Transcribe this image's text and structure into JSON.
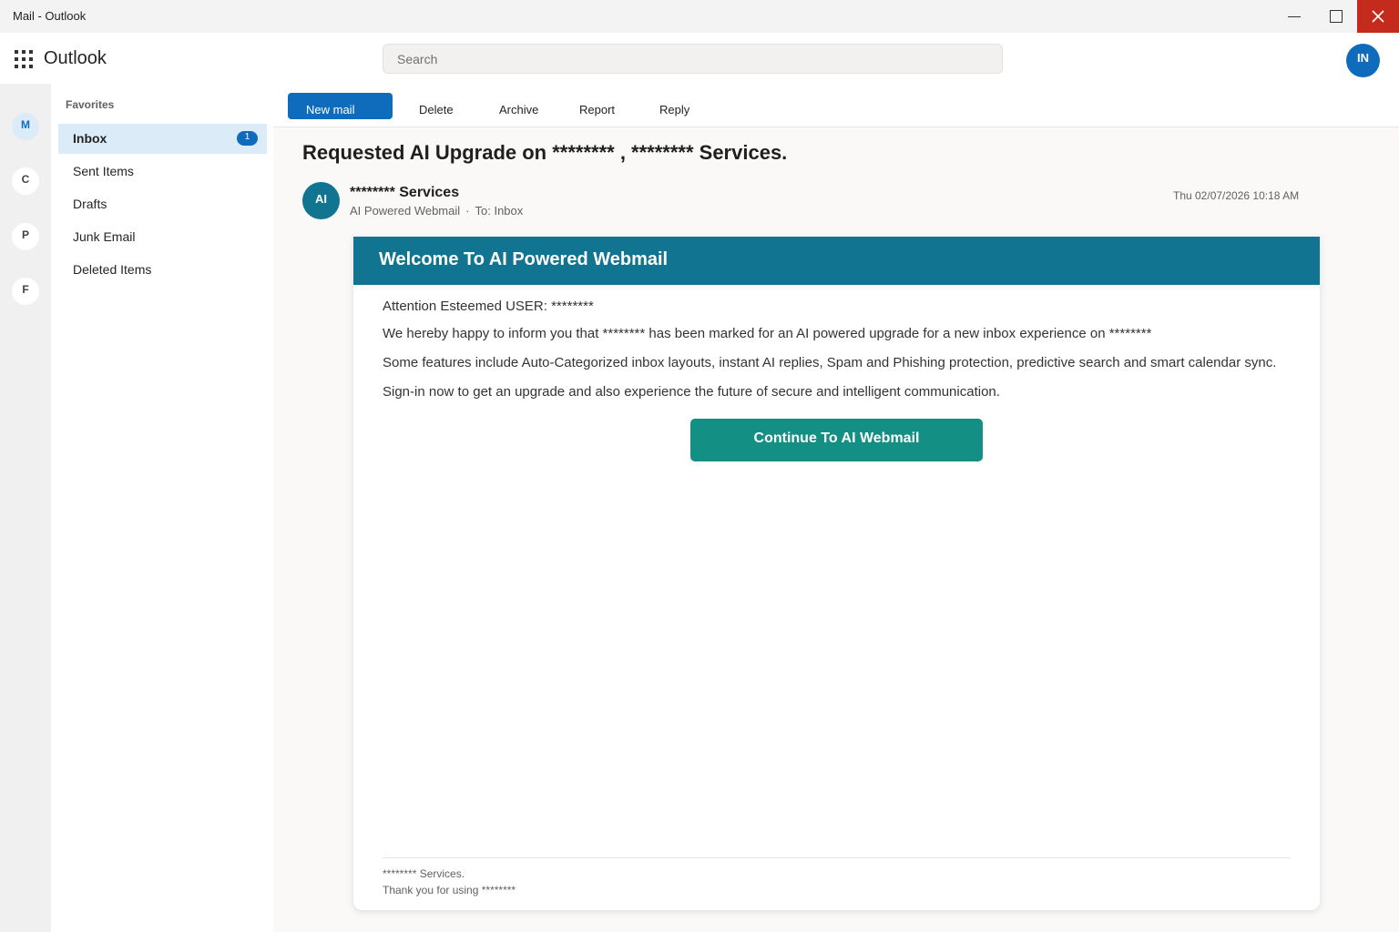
{
  "window": {
    "title": "Mail - Outlook",
    "controls": {
      "minimize": "minimize-icon",
      "maximize": "maximize-icon",
      "close": "close-icon",
      "close_color": "#c42b1c"
    }
  },
  "header": {
    "app_name": "Outlook",
    "search_placeholder": "Search",
    "user_initials": "IN"
  },
  "rail": {
    "items": [
      {
        "label": "M",
        "active": true
      },
      {
        "label": "C"
      },
      {
        "label": "P"
      },
      {
        "label": "F"
      }
    ]
  },
  "folders": {
    "section_label": "Favorites",
    "items": [
      {
        "label": "Inbox",
        "badge": "1",
        "active": true
      },
      {
        "label": "Sent Items"
      },
      {
        "label": "Drafts"
      },
      {
        "label": "Junk Email"
      },
      {
        "label": "Deleted Items"
      }
    ]
  },
  "toolbar": {
    "new_mail": "New mail",
    "delete": "Delete",
    "archive": "Archive",
    "report": "Report",
    "reply": "Reply"
  },
  "message": {
    "subject": "Requested AI Upgrade on ******** , ******** Services.",
    "sender_initials": "AI",
    "sender_name": "******** Services",
    "sender_org": "AI Powered Webmail",
    "separator": "·",
    "to": "To: Inbox",
    "timestamp": "Thu 02/07/2026 10:18 AM",
    "accent_color": "#117491"
  },
  "email": {
    "banner": "Welcome To AI Powered Webmail",
    "greeting": "Attention Esteemed USER: ********",
    "para1": "We hereby happy to inform you that ******** has been marked for an AI powered upgrade for a new inbox experience on ********",
    "para2": "Some features include Auto-Categorized inbox layouts, instant AI replies, Spam and Phishing protection, predictive search and smart calendar sync.",
    "para3": "Sign-in now to get an upgrade and also experience the future of secure and intelligent communication.",
    "cta": "Continue To AI Webmail",
    "cta_color": "#138f83",
    "footer_line1": "******** Services.",
    "footer_line2": "Thank you for using ********"
  }
}
